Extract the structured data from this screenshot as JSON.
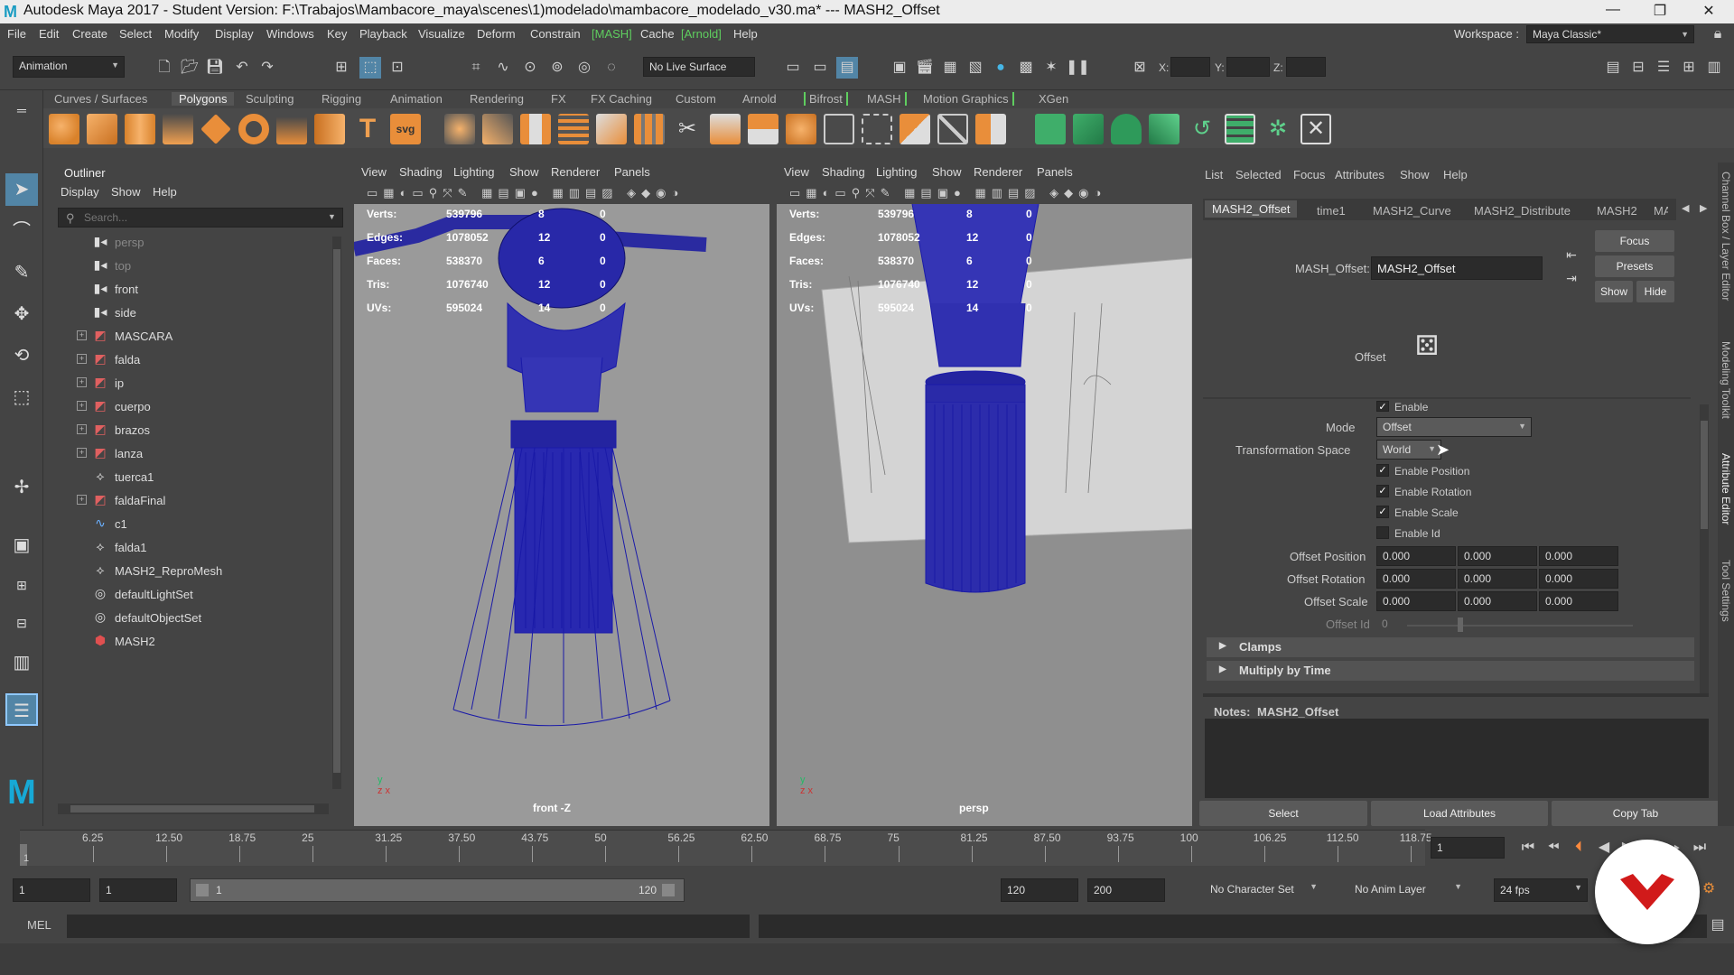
{
  "window": {
    "title": "Autodesk Maya 2017 - Student Version: F:\\Trabajos\\Mambacore_maya\\scenes\\1)modelado\\mambacore_modelado_v30.ma*  ---  MASH2_Offset",
    "logo_letter": "M"
  },
  "menubar": {
    "items": [
      "File",
      "Edit",
      "Create",
      "Select",
      "Modify",
      "Display",
      "Windows",
      "Key",
      "Playback",
      "Visualize",
      "Deform",
      "Constrain",
      "[MASH]",
      "Cache",
      "[Arnold]",
      "Help"
    ],
    "workspace_label": "Workspace :",
    "workspace_value": "Maya Classic*"
  },
  "statusline": {
    "mode": "Animation",
    "live_surface": "No Live Surface",
    "x_label": "X:",
    "y_label": "Y:",
    "z_label": "Z:"
  },
  "shelf_tabs": [
    "Curves / Surfaces",
    "Polygons",
    "Sculpting",
    "Rigging",
    "Animation",
    "Rendering",
    "FX",
    "FX Caching",
    "Custom",
    "Arnold",
    "Bifrost",
    "MASH",
    "Motion Graphics",
    "XGen"
  ],
  "outliner": {
    "title": "Outliner",
    "menus": [
      "Display",
      "Show",
      "Help"
    ],
    "search_placeholder": "Search...",
    "items": [
      {
        "label": "persp",
        "icon": "camera-icon",
        "expand": false,
        "dim": true
      },
      {
        "label": "top",
        "icon": "camera-icon",
        "expand": false,
        "dim": true
      },
      {
        "label": "front",
        "icon": "camera-icon",
        "expand": false,
        "dim": false
      },
      {
        "label": "side",
        "icon": "camera-icon",
        "expand": false,
        "dim": false
      },
      {
        "label": "MASCARA",
        "icon": "mesh-icon",
        "expand": true,
        "dim": false
      },
      {
        "label": "falda",
        "icon": "mesh-icon",
        "expand": true,
        "dim": false
      },
      {
        "label": "ip",
        "icon": "mesh-icon",
        "expand": true,
        "dim": false
      },
      {
        "label": "cuerpo",
        "icon": "mesh-icon",
        "expand": true,
        "dim": false
      },
      {
        "label": "brazos",
        "icon": "mesh-icon",
        "expand": true,
        "dim": false
      },
      {
        "label": "lanza",
        "icon": "mesh-icon",
        "expand": true,
        "dim": false
      },
      {
        "label": "tuerca1",
        "icon": "transform-icon",
        "expand": false,
        "dim": false
      },
      {
        "label": "faldaFinal",
        "icon": "mesh-icon",
        "expand": true,
        "dim": false
      },
      {
        "label": "c1",
        "icon": "curve-icon",
        "expand": false,
        "dim": false
      },
      {
        "label": "falda1",
        "icon": "transform-icon",
        "expand": false,
        "dim": false
      },
      {
        "label": "MASH2_ReproMesh",
        "icon": "transform-icon",
        "expand": false,
        "dim": false
      },
      {
        "label": "defaultLightSet",
        "icon": "set-icon",
        "expand": false,
        "dim": false
      },
      {
        "label": "defaultObjectSet",
        "icon": "set-icon",
        "expand": false,
        "dim": false
      },
      {
        "label": "MASH2",
        "icon": "mash-icon",
        "expand": false,
        "dim": false
      }
    ]
  },
  "viewport_menus": [
    "View",
    "Shading",
    "Lighting",
    "Show",
    "Renderer",
    "Panels"
  ],
  "hud": {
    "labels": [
      "Verts:",
      "Edges:",
      "Faces:",
      "Tris:",
      "UVs:"
    ],
    "v1": [
      "539796",
      "1078052",
      "538370",
      "1076740",
      "595024"
    ],
    "v2": [
      "8",
      "12",
      "6",
      "12",
      "14"
    ],
    "v3": [
      "0",
      "0",
      "0",
      "0",
      "0"
    ]
  },
  "viewport_front": {
    "camera_label": "front -Z"
  },
  "viewport_persp": {
    "camera_label": "persp"
  },
  "attr_editor": {
    "menus": [
      "List",
      "Selected",
      "Focus",
      "Attributes",
      "Show",
      "Help"
    ],
    "tabs": [
      "MASH2_Offset",
      "time1",
      "MASH2_Curve",
      "MASH2_Distribute",
      "MASH2",
      "MA"
    ],
    "node_label": "MASH_Offset:",
    "node_value": "MASH2_Offset",
    "focus": "Focus",
    "presets": "Presets",
    "show": "Show",
    "hide": "Hide",
    "offset_label": "Offset",
    "enable_label": "Enable",
    "mode_label": "Mode",
    "mode_value": "Offset",
    "space_label": "Transformation Space",
    "space_value": "World",
    "enable_position": "Enable Position",
    "enable_rotation": "Enable Rotation",
    "enable_scale": "Enable Scale",
    "enable_id": "Enable Id",
    "offset_position_label": "Offset Position",
    "offset_position": [
      "0.000",
      "0.000",
      "0.000"
    ],
    "offset_rotation_label": "Offset Rotation",
    "offset_rotation": [
      "0.000",
      "0.000",
      "0.000"
    ],
    "offset_scale_label": "Offset Scale",
    "offset_scale": [
      "0.000",
      "0.000",
      "0.000"
    ],
    "offset_id_label": "Offset Id",
    "offset_id": "0",
    "frames": [
      "Clamps",
      "Multiply by Time"
    ],
    "notes_label": "Notes:",
    "notes_node": "MASH2_Offset",
    "select": "Select",
    "load_attributes": "Load Attributes",
    "copy_tab": "Copy Tab"
  },
  "side_tabs": [
    "Channel Box / Layer Editor",
    "Modeling Toolkit",
    "Attribute Editor",
    "Tool Settings"
  ],
  "timeslider": {
    "ticks": [
      "6.25",
      "12.50",
      "18.75",
      "25",
      "31.25",
      "37.50",
      "43.75",
      "50",
      "56.25",
      "62.50",
      "68.75",
      "75",
      "81.25",
      "87.50",
      "93.75",
      "100",
      "106.25",
      "112.50",
      "118.75"
    ],
    "current_frame": "1",
    "start_marker": "1"
  },
  "range": {
    "start": "1",
    "anim_start": "1",
    "range_start": "1",
    "range_end": "120",
    "end": "120",
    "anim_end": "200",
    "character_set": "No Character Set",
    "anim_layer": "No Anim Layer",
    "fps": "24 fps"
  },
  "cmdline": {
    "label": "MEL"
  }
}
